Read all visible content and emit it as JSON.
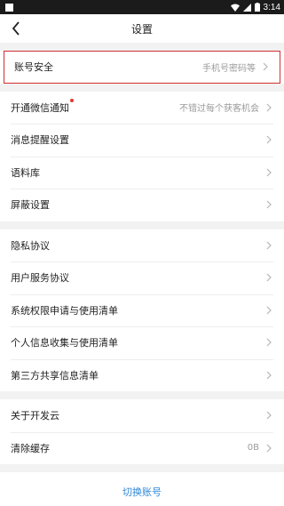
{
  "status": {
    "time": "3:14"
  },
  "header": {
    "title": "设置"
  },
  "group1": [
    {
      "label": "账号安全",
      "value": "手机号密码等"
    }
  ],
  "group2": [
    {
      "label": "开通微信通知",
      "value": "不错过每个获客机会",
      "dot": true
    },
    {
      "label": "消息提醒设置",
      "value": ""
    },
    {
      "label": "语料库",
      "value": ""
    },
    {
      "label": "屏蔽设置",
      "value": ""
    }
  ],
  "group3": [
    {
      "label": "隐私协议"
    },
    {
      "label": "用户服务协议"
    },
    {
      "label": "系统权限申请与使用清单"
    },
    {
      "label": "个人信息收集与使用清单"
    },
    {
      "label": "第三方共享信息清单"
    }
  ],
  "group4": [
    {
      "label": "关于开发云",
      "value": ""
    },
    {
      "label": "清除缓存",
      "value": "0B"
    }
  ],
  "footer": {
    "switch_account": "切换账号"
  }
}
